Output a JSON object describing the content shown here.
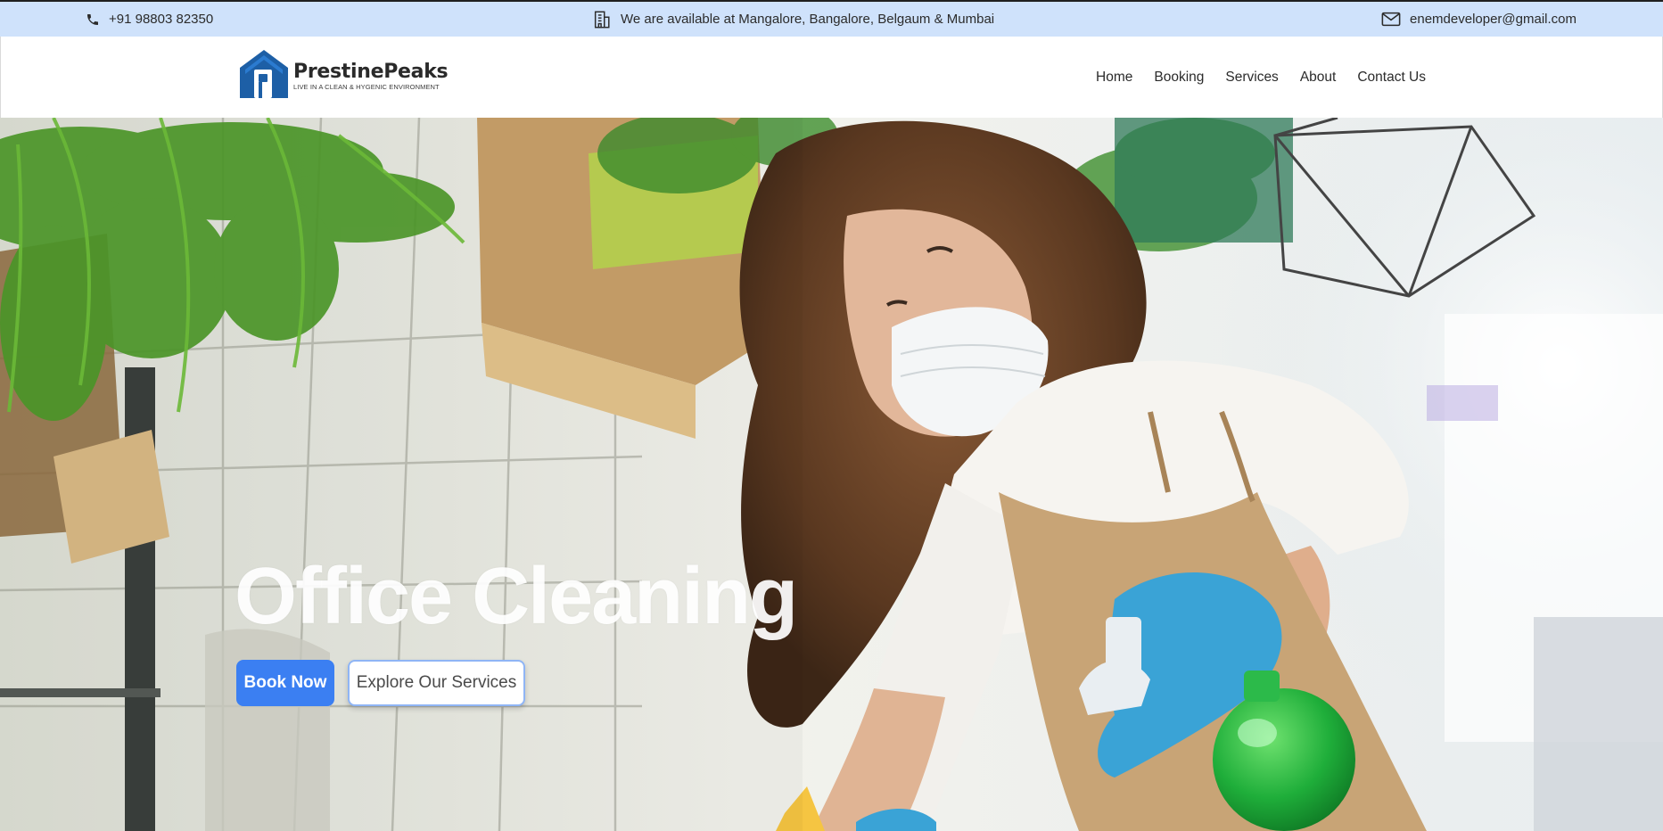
{
  "topbar": {
    "phone": "+91 98803 82350",
    "locations": "We are available at Mangalore, Bangalore, Belgaum & Mumbai",
    "email": "enemdeveloper@gmail.com",
    "icons": [
      "phone-icon",
      "building-icon",
      "mail-icon"
    ]
  },
  "header": {
    "brand": "PrestinePeaks",
    "tagline": "LIVE IN A CLEAN & HYGENIC ENVIRONMENT",
    "nav": [
      "Home",
      "Booking",
      "Services",
      "About",
      "Contact Us"
    ]
  },
  "hero": {
    "title": "Office Cleaning",
    "primary_button": "Book Now",
    "secondary_button": "Explore Our Services"
  },
  "colors": {
    "topbar_bg": "#cfe2fb",
    "brand_blue": "#1d5fa6",
    "primary_button": "#3b7ff2"
  }
}
